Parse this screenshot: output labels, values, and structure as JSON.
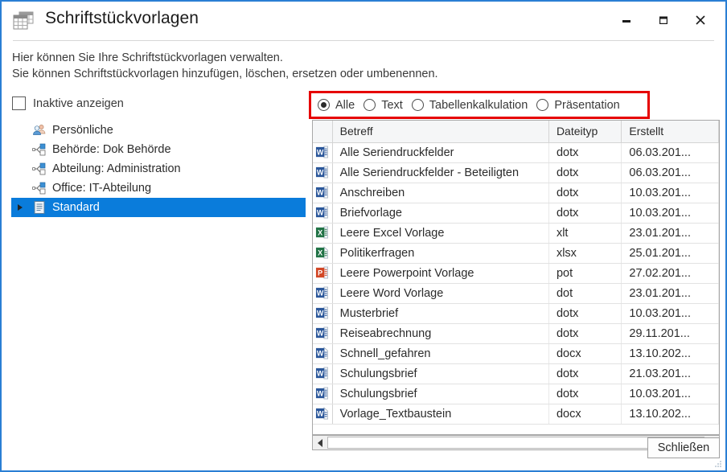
{
  "window": {
    "title": "Schriftstückvorlagen",
    "icon": "table-templates-icon",
    "border_color": "#2a7fd4",
    "controls": {
      "minimize": "minimize-icon",
      "maximize": "maximize-icon",
      "close": "close-icon"
    }
  },
  "description": {
    "line1": "Hier können Sie Ihre Schriftstückvorlagen verwalten.",
    "line2": "Sie können Schriftstückvorlagen hinzufügen, löschen, ersetzen oder umbenennen."
  },
  "checkbox": {
    "label": "Inaktive anzeigen",
    "checked": false
  },
  "filter": {
    "highlight_color": "#e60000",
    "selected": "Alle",
    "options": [
      {
        "label": "Alle",
        "selected": true
      },
      {
        "label": "Text",
        "selected": false
      },
      {
        "label": "Tabellenkalkulation",
        "selected": false
      },
      {
        "label": "Präsentation",
        "selected": false
      }
    ]
  },
  "tree": {
    "selection_color": "#0a7cdb",
    "items": [
      {
        "label": "Persönliche",
        "icon": "persons-icon",
        "selected": false,
        "expandable": false
      },
      {
        "label": "Behörde: Dok Behörde",
        "icon": "org-node-icon",
        "selected": false,
        "expandable": false
      },
      {
        "label": "Abteilung: Administration",
        "icon": "org-node-icon",
        "selected": false,
        "expandable": false
      },
      {
        "label": "Office: IT-Abteilung",
        "icon": "org-node-icon",
        "selected": false,
        "expandable": false
      },
      {
        "label": "Standard",
        "icon": "document-icon",
        "selected": true,
        "expandable": true
      }
    ]
  },
  "table": {
    "columns": [
      "",
      "Betreff",
      "Dateityp",
      "Erstellt"
    ],
    "rows": [
      {
        "icon": "word-template-icon",
        "betreff": "Alle Seriendruckfelder",
        "dateityp": "dotx",
        "erstellt": "06.03.201..."
      },
      {
        "icon": "word-template-icon",
        "betreff": "Alle Seriendruckfelder - Beteiligten",
        "dateityp": "dotx",
        "erstellt": "06.03.201..."
      },
      {
        "icon": "word-template-icon",
        "betreff": "Anschreiben",
        "dateityp": "dotx",
        "erstellt": "10.03.201..."
      },
      {
        "icon": "word-template-icon",
        "betreff": "Briefvorlage",
        "dateityp": "dotx",
        "erstellt": "10.03.201..."
      },
      {
        "icon": "excel-template-icon",
        "betreff": "Leere Excel Vorlage",
        "dateityp": "xlt",
        "erstellt": "23.01.201..."
      },
      {
        "icon": "excel-document-icon",
        "betreff": "Politikerfragen",
        "dateityp": "xlsx",
        "erstellt": "25.01.201..."
      },
      {
        "icon": "powerpoint-template-icon",
        "betreff": "Leere Powerpoint Vorlage",
        "dateityp": "pot",
        "erstellt": "27.02.201..."
      },
      {
        "icon": "word-template-icon",
        "betreff": "Leere Word Vorlage",
        "dateityp": "dot",
        "erstellt": "23.01.201..."
      },
      {
        "icon": "word-template-icon",
        "betreff": "Musterbrief",
        "dateityp": "dotx",
        "erstellt": "10.03.201..."
      },
      {
        "icon": "word-template-icon",
        "betreff": "Reiseabrechnung",
        "dateityp": "dotx",
        "erstellt": "29.11.201..."
      },
      {
        "icon": "word-document-icon",
        "betreff": "Schnell_gefahren",
        "dateityp": "docx",
        "erstellt": "13.10.202..."
      },
      {
        "icon": "word-template-icon",
        "betreff": "Schulungsbrief",
        "dateityp": "dotx",
        "erstellt": "21.03.201..."
      },
      {
        "icon": "word-template-icon",
        "betreff": "Schulungsbrief",
        "dateityp": "dotx",
        "erstellt": "10.03.201..."
      },
      {
        "icon": "word-document-icon",
        "betreff": "Vorlage_Textbaustein",
        "dateityp": "docx",
        "erstellt": "13.10.202..."
      }
    ]
  },
  "scrollbar": {
    "left_arrow": "scroll-left-icon",
    "right_arrow": "scroll-right-icon"
  },
  "footer": {
    "close_label": "Schließen"
  }
}
